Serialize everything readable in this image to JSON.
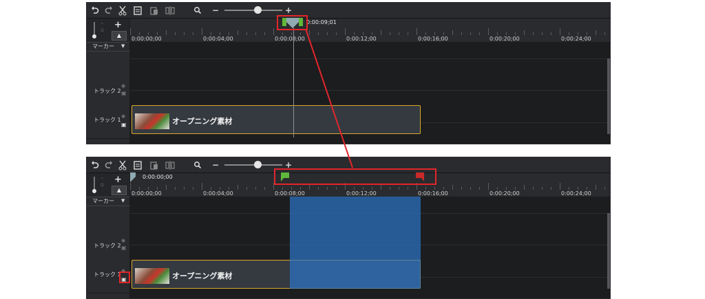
{
  "toolbar": {
    "icons": [
      "undo-icon",
      "redo-icon",
      "cut-icon",
      "copy-icon",
      "paste-icon",
      "split-icon",
      "search-icon"
    ],
    "zoom_minus": "−",
    "zoom_plus": "+"
  },
  "side": {
    "plus": "+",
    "collapse": "▲",
    "marker_label": "マーカー",
    "marker_arrow": "▼"
  },
  "ruler_labels": [
    "0:00:00;00",
    "0:00:04;00",
    "0:00:08;00",
    "0:00:12;00",
    "0:00:16;00",
    "0:00:20;00",
    "0:00:24;00"
  ],
  "tracks": [
    {
      "name": "トラック 2"
    },
    {
      "name": "トラック 1"
    }
  ],
  "clip": {
    "name": "オープニング素材"
  },
  "panel1": {
    "playhead_time": "0:00:09;01"
  },
  "panel2": {
    "playhead_time": "0:00:00;00"
  },
  "colors": {
    "accent_red": "#e3262b",
    "selection_blue": "#2d73c3",
    "clip_border": "#d9a82a",
    "marker_green": "#5fb83a",
    "marker_red": "#c92a2a"
  }
}
